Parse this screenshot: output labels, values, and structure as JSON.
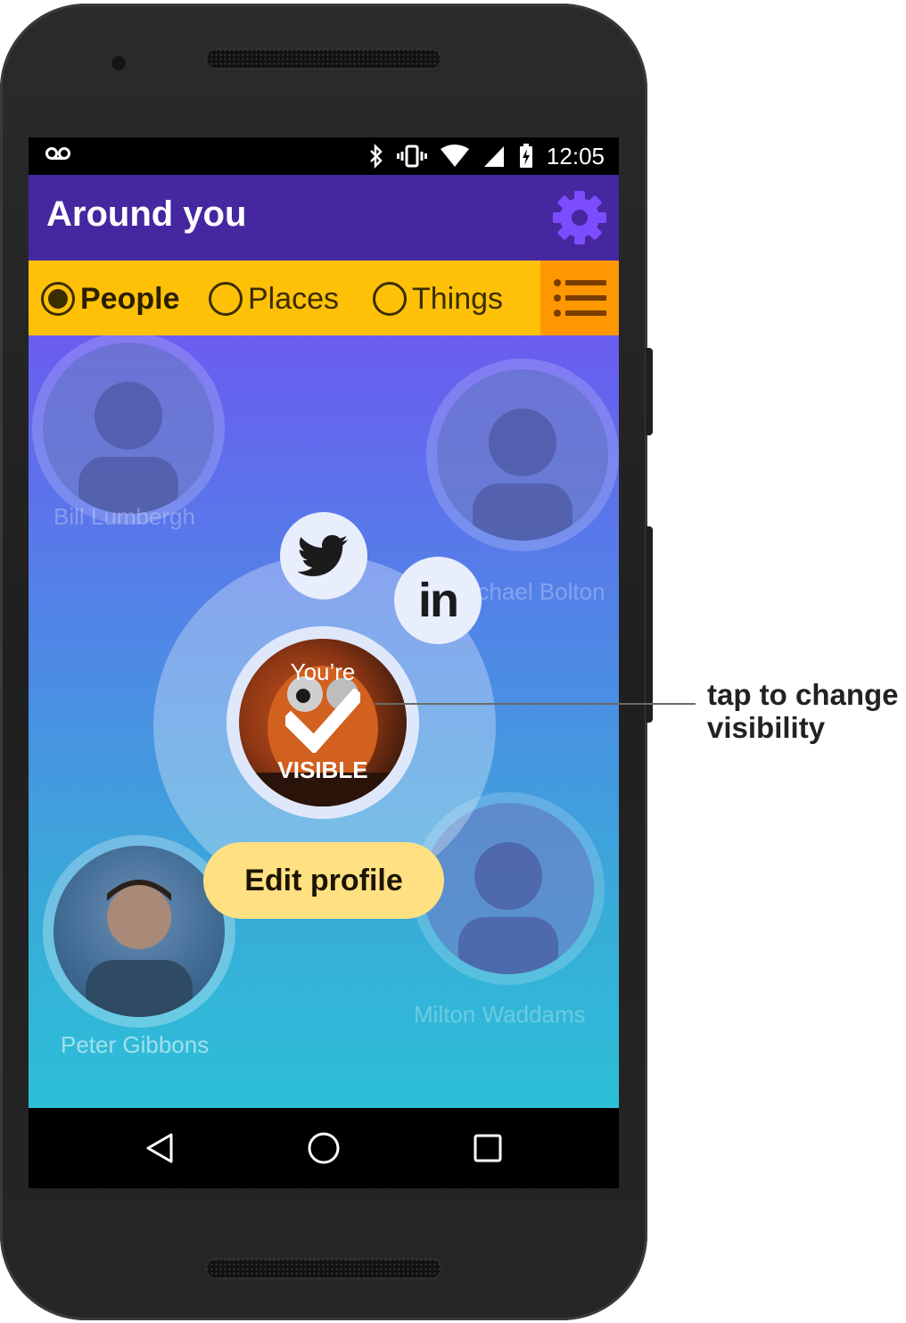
{
  "status_bar": {
    "voicemail_icon": "voicemail-icon",
    "icons": [
      "bluetooth-icon",
      "vibrate-icon",
      "wifi-icon",
      "cell-signal-icon",
      "battery-charging-icon"
    ],
    "time": "12:05"
  },
  "app_bar": {
    "title": "Around you",
    "settings_icon": "gear-icon",
    "accent_color": "#4527a0",
    "gear_color": "#7c4dff"
  },
  "tabs": {
    "items": [
      {
        "label": "People",
        "selected": true
      },
      {
        "label": "Places",
        "selected": false
      },
      {
        "label": "Things",
        "selected": false
      }
    ],
    "menu_icon": "list-icon",
    "bar_color": "#ffc107",
    "menu_color": "#ff9800"
  },
  "people": [
    {
      "name": "Bill Lumbergh",
      "visible": false
    },
    {
      "name": "Michael Bolton",
      "visible": false
    },
    {
      "name": "Peter Gibbons",
      "visible": true
    },
    {
      "name": "Milton Waddams",
      "visible": false
    }
  ],
  "me": {
    "status_top": "You’re",
    "status_bottom": "VISIBLE",
    "status_icon": "checkmark-icon",
    "social": [
      "twitter-icon",
      "linkedin-icon"
    ],
    "linkedin_label": "in",
    "edit_profile_label": "Edit profile"
  },
  "nav_bar": {
    "icons": [
      "back-icon",
      "home-icon",
      "recents-icon"
    ]
  },
  "annotation": {
    "text": "tap to change visibility"
  }
}
